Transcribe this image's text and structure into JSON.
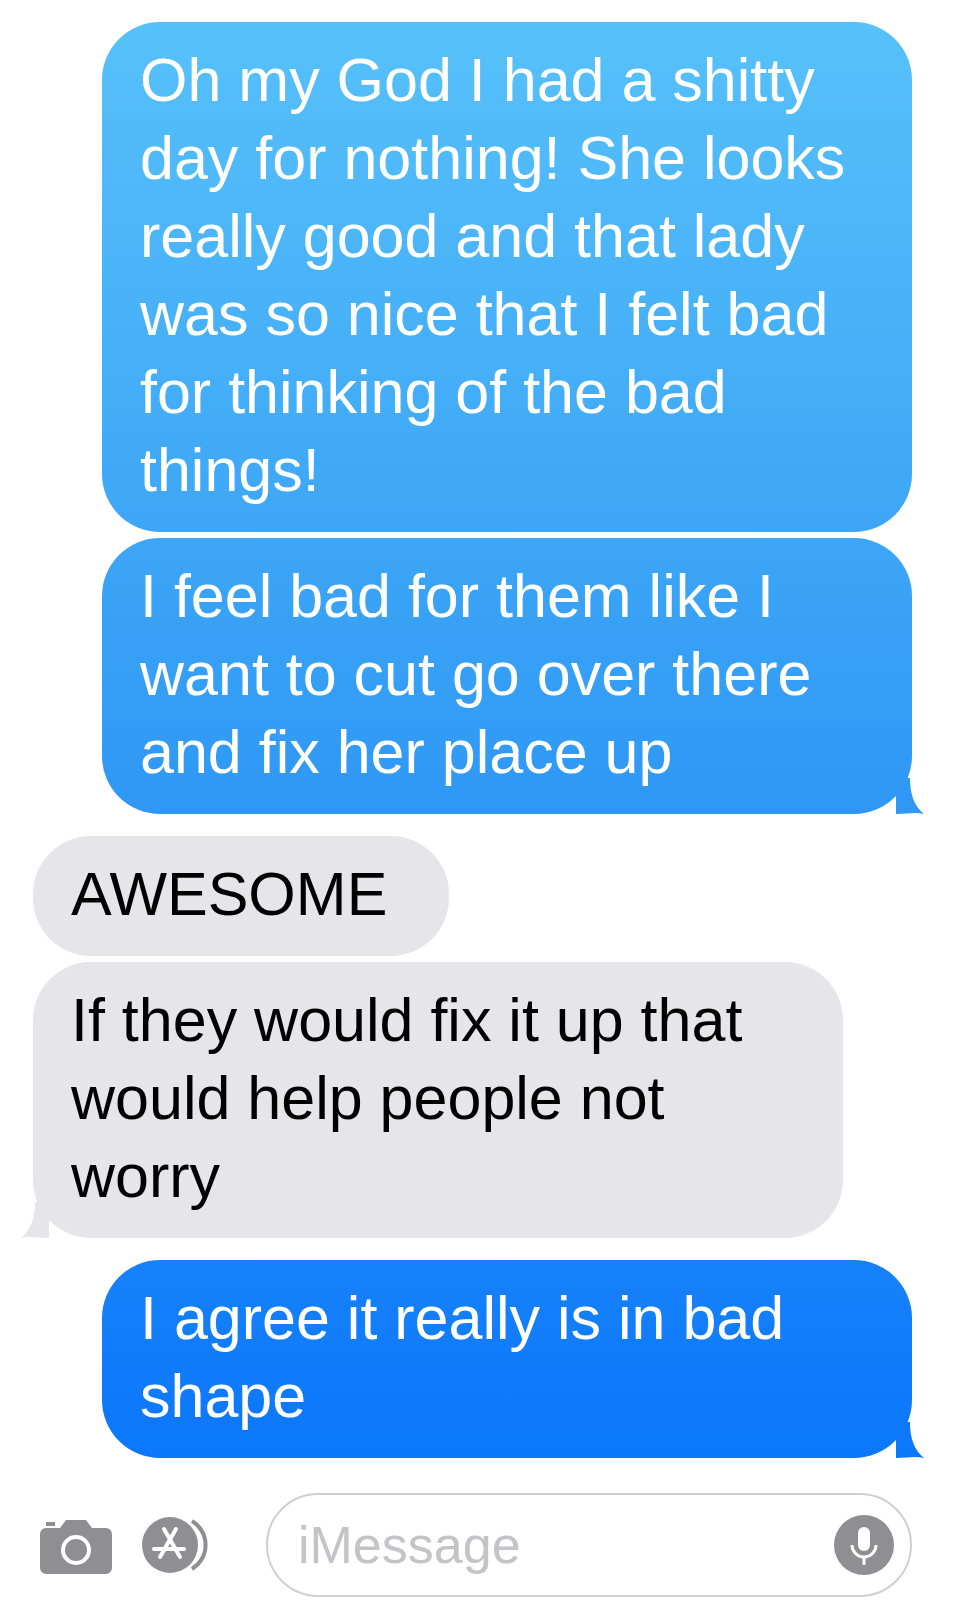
{
  "messages": [
    {
      "kind": "sent",
      "text": "Oh my God I had a shitty day for nothing! She looks really good and that lady was so nice that I felt bad for thinking of the bad things!",
      "tail": false
    },
    {
      "kind": "sent",
      "text": "I feel bad for them like I want to cut go over there and fix her place up",
      "tail": true
    },
    {
      "kind": "received",
      "text": "AWESOME",
      "tail": false
    },
    {
      "kind": "received",
      "text": "If they would fix it up that would help people not worry",
      "tail": true
    },
    {
      "kind": "sent",
      "text": "I agree it really is in bad shape",
      "tail": true
    }
  ],
  "composer": {
    "placeholder": "iMessage"
  }
}
